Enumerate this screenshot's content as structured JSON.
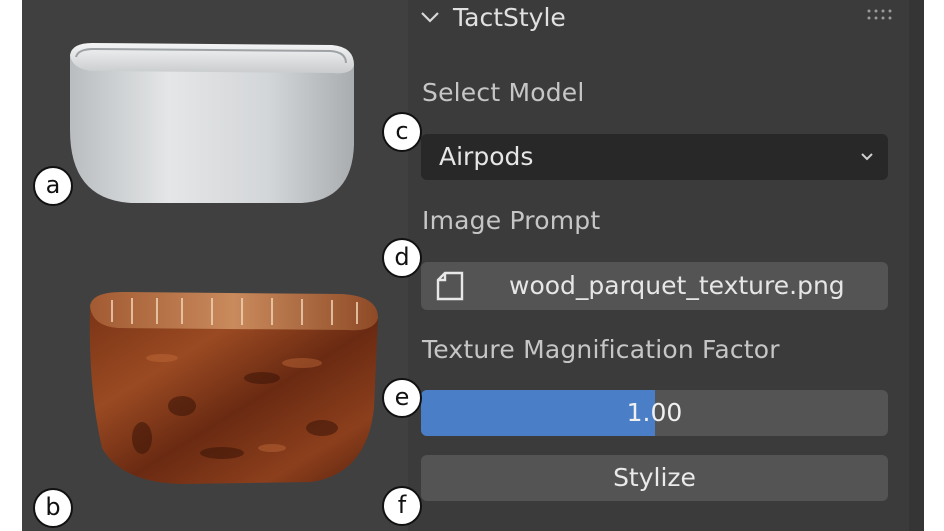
{
  "panel": {
    "title": "TactStyle",
    "select_model": {
      "label": "Select Model",
      "value": "Airpods"
    },
    "image_prompt": {
      "label": "Image Prompt",
      "file": "wood_parquet_texture.png"
    },
    "magnification": {
      "label": "Texture Magnification Factor",
      "value_text": "1.00",
      "fill_fraction": 0.5
    },
    "stylize_label": "Stylize"
  },
  "markers": {
    "a": "a",
    "b": "b",
    "c": "c",
    "d": "d",
    "e": "e",
    "f": "f"
  },
  "colors": {
    "accent": "#4a7fc7",
    "panel_bg": "#3b3b3b",
    "field_bg": "#545454",
    "dropdown_bg": "#282828"
  },
  "icons": [
    "chevron-down-icon",
    "drag-grip-icon",
    "file-icon"
  ]
}
